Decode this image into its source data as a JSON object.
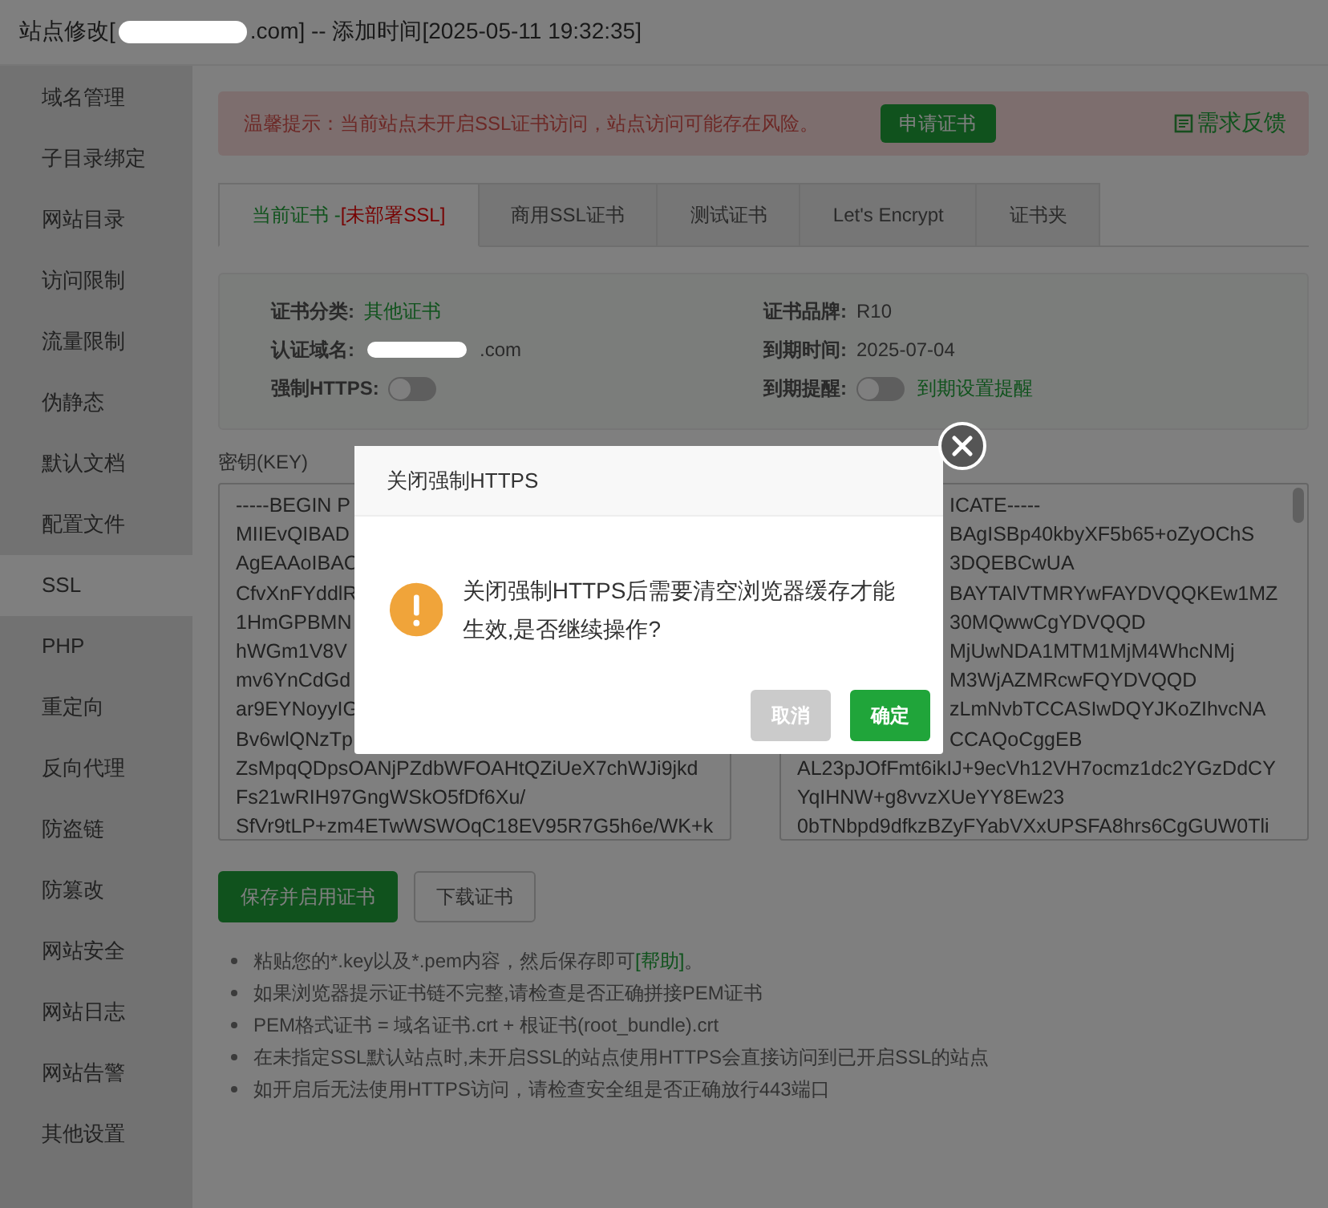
{
  "window": {
    "title_prefix": "站点修改[",
    "title_suffix": ".com] -- 添加时间[2025-05-11 19:32:35]"
  },
  "sidebar": {
    "items": [
      {
        "label": "域名管理",
        "selected": false
      },
      {
        "label": "子目录绑定",
        "selected": false
      },
      {
        "label": "网站目录",
        "selected": false
      },
      {
        "label": "访问限制",
        "selected": false
      },
      {
        "label": "流量限制",
        "selected": false
      },
      {
        "label": "伪静态",
        "selected": false
      },
      {
        "label": "默认文档",
        "selected": false
      },
      {
        "label": "配置文件",
        "selected": false
      },
      {
        "label": "SSL",
        "selected": true
      },
      {
        "label": "PHP",
        "selected": false
      },
      {
        "label": "重定向",
        "selected": false
      },
      {
        "label": "反向代理",
        "selected": false
      },
      {
        "label": "防盗链",
        "selected": false
      },
      {
        "label": "防篡改",
        "selected": false
      },
      {
        "label": "网站安全",
        "selected": false
      },
      {
        "label": "网站日志",
        "selected": false
      },
      {
        "label": "网站告警",
        "selected": false
      },
      {
        "label": "其他设置",
        "selected": false
      }
    ]
  },
  "alert": {
    "text": "温馨提示：当前站点未开启SSL证书访问，站点访问可能存在风险。",
    "button": "申请证书",
    "feedback": "需求反馈"
  },
  "tabs": [
    {
      "label": "当前证书 -",
      "status": "[未部署SSL]",
      "selected": true
    },
    {
      "label": "商用SSL证书",
      "selected": false
    },
    {
      "label": "测试证书",
      "selected": false
    },
    {
      "label": "Let's Encrypt",
      "selected": false
    },
    {
      "label": "证书夹",
      "selected": false
    }
  ],
  "info": {
    "left": [
      {
        "label": "证书分类:",
        "kind": "link",
        "value": "其他证书"
      },
      {
        "label": "认证域名:",
        "kind": "redacted",
        "value": ".com"
      },
      {
        "label": "强制HTTPS:",
        "kind": "toggle",
        "on": false
      }
    ],
    "right": [
      {
        "label": "证书品牌:",
        "kind": "text",
        "value": "R10"
      },
      {
        "label": "到期时间:",
        "kind": "text",
        "value": "2025-07-04"
      },
      {
        "label": "到期提醒:",
        "kind": "toggle",
        "on": false,
        "link": "到期设置提醒"
      }
    ]
  },
  "key": {
    "label": "密钥(KEY)",
    "lines": [
      {
        "text": "-----BEGIN P"
      },
      {
        "text": "MIIEvQIBAD"
      },
      {
        "text": "AgEAAoIBAC"
      },
      {
        "text": "CfvXnFYddlR"
      },
      {
        "text": "1HmGPBMN"
      },
      {
        "text": "hWGm1V8V"
      },
      {
        "text": "mv6YnCdGd"
      },
      {
        "text": "ar9EYNoyyIG"
      },
      {
        "text": "Bv6wlQNzTp"
      },
      {
        "text": "ZsMpqQDpsOANjPZdbWFOAHtQZiUeX7chWJi9jkd"
      },
      {
        "text": "Fs21wRIH97GngWSkO5fDf6Xu/"
      },
      {
        "text": "SfVr9tLP+zm4ETwWSWOqC18EV95R7G5h6e/WK+k"
      }
    ]
  },
  "cert": {
    "partly_covered_lines": [
      {
        "text": "ICATE-----"
      },
      {
        "text": "BAgISBp40kbyXF5b65+oZyOChS"
      },
      {
        "text": "3DQEBCwUA"
      },
      {
        "text": "BAYTAlVTMRYwFAYDVQQKEw1MZ"
      },
      {
        "text": "30MQwwCgYDVQQD"
      },
      {
        "text": "MjUwNDA1MTM1MjM4WhcNMj"
      },
      {
        "text": "M3WjAZMRcwFQYDVQQD"
      },
      {
        "text": "zLmNvbTCCASIwDQYJKoZIhvcNA"
      },
      {
        "text": "CCAQoCggEB"
      }
    ],
    "lines": [
      {
        "text": "AL23pJOfFmt6ikIJ+9ecVh12VH7ocmz1dc2YGzDdCY"
      },
      {
        "text": "YqIHNW+g8vvzXUeYY8Ew23"
      },
      {
        "text": "0bTNbpd9dfkzBZyFYabVXxUPSFA8hrs6CgGUW0Tli"
      }
    ]
  },
  "actions": [
    {
      "label": "保存并启用证书",
      "kind": "primary"
    },
    {
      "label": "下载证书",
      "kind": "default"
    }
  ],
  "notes": [
    {
      "text": "粘贴您的*.key以及*.pem内容，然后保存即可",
      "link": "[帮助]",
      "after": "。"
    },
    {
      "text": "如果浏览器提示证书链不完整,请检查是否正确拼接PEM证书"
    },
    {
      "text": "PEM格式证书 = 域名证书.crt + 根证书(root_bundle).crt"
    },
    {
      "text": "在未指定SSL默认站点时,未开启SSL的站点使用HTTPS会直接访问到已开启SSL的站点"
    },
    {
      "text": "如开启后无法使用HTTPS访问，请检查安全组是否正确放行443端口"
    }
  ],
  "dialog": {
    "title": "关闭强制HTTPS",
    "message": "关闭强制HTTPS后需要清空浏览器缓存才能生效,是否继续操作?",
    "cancel": "取消",
    "confirm": "确定"
  }
}
